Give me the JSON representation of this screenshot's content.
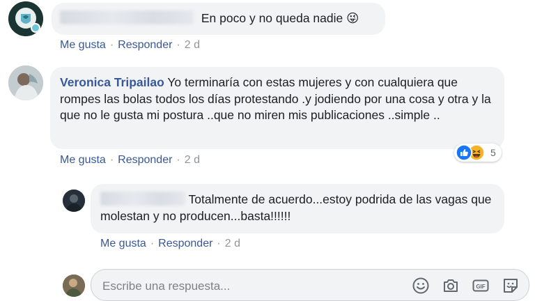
{
  "comments": [
    {
      "author": "",
      "text": "En poco y no queda nadie 😜",
      "actions": {
        "like": "Me gusta",
        "reply": "Responder",
        "time": "2 d"
      }
    },
    {
      "author": "Veronica Tripailao",
      "text": "Yo terminaría con estas mujeres y con cualquiera que rompes las bolas todos los días protestando .y jodiendo por una cosa y otra y la que no le gusta mi postura ..que no miren mis publicaciones ..simple ..",
      "actions": {
        "like": "Me gusta",
        "reply": "Responder",
        "time": "2 d"
      },
      "reactions": {
        "types": [
          "like-icon",
          "haha-icon"
        ],
        "count": "5"
      }
    },
    {
      "author": "",
      "text": "Totalmente de acuerdo...estoy podrida de las vagas que molestan y no producen...basta!!!!!!",
      "actions": {
        "like": "Me gusta",
        "reply": "Responder",
        "time": "2 d"
      }
    }
  ],
  "reply_box": {
    "placeholder": "Escribe una respuesta...",
    "tools": [
      "emoji-icon",
      "camera-icon",
      "gif-icon",
      "sticker-icon"
    ]
  },
  "colors": {
    "link": "#385898",
    "bubble": "#f2f3f5",
    "meta": "#90949c",
    "like_blue": "#1877f2",
    "haha_yellow": "#f7b125"
  }
}
